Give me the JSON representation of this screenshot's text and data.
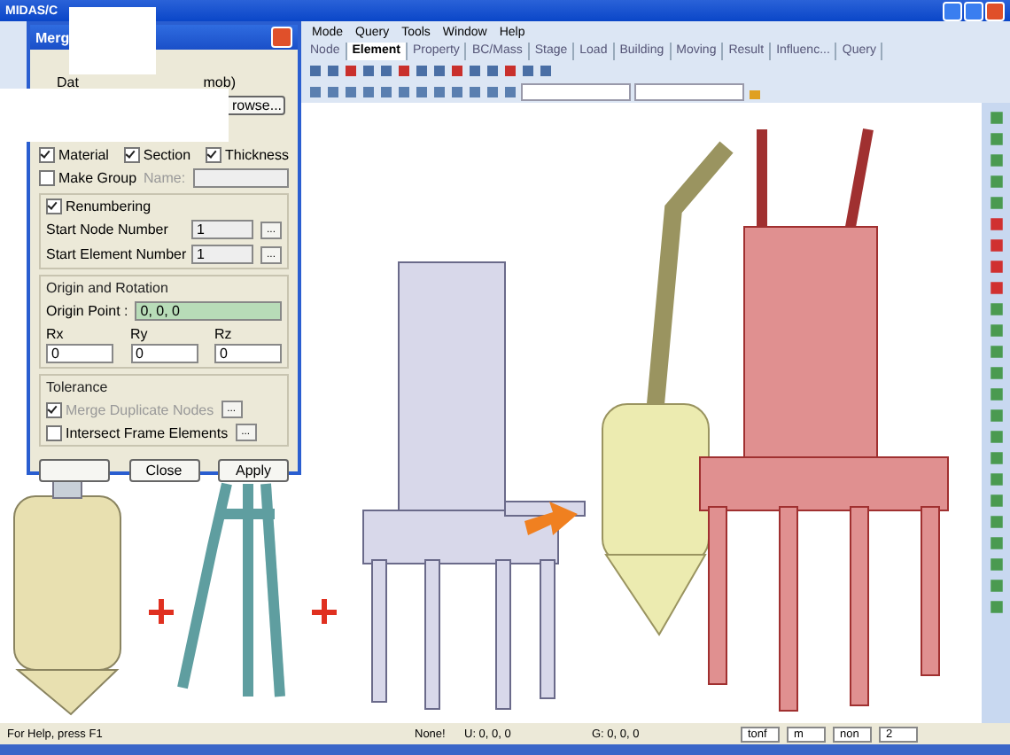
{
  "app_window": {
    "title": "MIDAS/C"
  },
  "menu": [
    "Mode",
    "Query",
    "Tools",
    "Window",
    "Help"
  ],
  "tabs": [
    {
      "label": "Node",
      "selected": false
    },
    {
      "label": "Element",
      "selected": true
    },
    {
      "label": "Property",
      "selected": false
    },
    {
      "label": "BC/Mass",
      "selected": false
    },
    {
      "label": "Stage",
      "selected": false
    },
    {
      "label": "Load",
      "selected": false
    },
    {
      "label": "Building",
      "selected": false
    },
    {
      "label": "Moving",
      "selected": false
    },
    {
      "label": "Result",
      "selected": false
    },
    {
      "label": "Influenc...",
      "selected": false
    },
    {
      "label": "Query",
      "selected": false
    }
  ],
  "dialog": {
    "title": "Merg",
    "data_label": "Dat",
    "file_hint": "mob)",
    "browse_button": "rowse...",
    "options": [
      {
        "label": "Material",
        "checked": true
      },
      {
        "label": "Section",
        "checked": true
      },
      {
        "label": "Thickness",
        "checked": true
      }
    ],
    "make_group": {
      "label": "Make Group",
      "checked": false,
      "name_label": "Name:"
    },
    "renumbering": {
      "label": "Renumbering",
      "checked": true,
      "fields": [
        {
          "label": "Start Node Number",
          "value": "1",
          "button": "..."
        },
        {
          "label": "Start Element Number",
          "value": "1",
          "button": "..."
        }
      ]
    },
    "origin": {
      "title": "Origin and Rotation",
      "point_label": "Origin Point :",
      "point_value": "0, 0, 0",
      "rotations": [
        {
          "label": "Rx",
          "value": "0"
        },
        {
          "label": "Ry",
          "value": "0"
        },
        {
          "label": "Rz",
          "value": "0"
        }
      ]
    },
    "tolerance": {
      "title": "Tolerance",
      "options": [
        {
          "label": "Merge Duplicate Nodes",
          "checked": true,
          "disabled": true,
          "button": "..."
        },
        {
          "label": "Intersect Frame Elements",
          "checked": false,
          "disabled": false,
          "button": "..."
        }
      ]
    },
    "buttons": [
      "Close",
      "Apply"
    ]
  },
  "status_bar": {
    "help": "For Help, press F1",
    "selection": "None!",
    "u": "U: 0, 0, 0",
    "g": "G: 0, 0, 0",
    "force_unit": "tonf",
    "length_unit": "m",
    "mode": "non",
    "page": "2"
  }
}
